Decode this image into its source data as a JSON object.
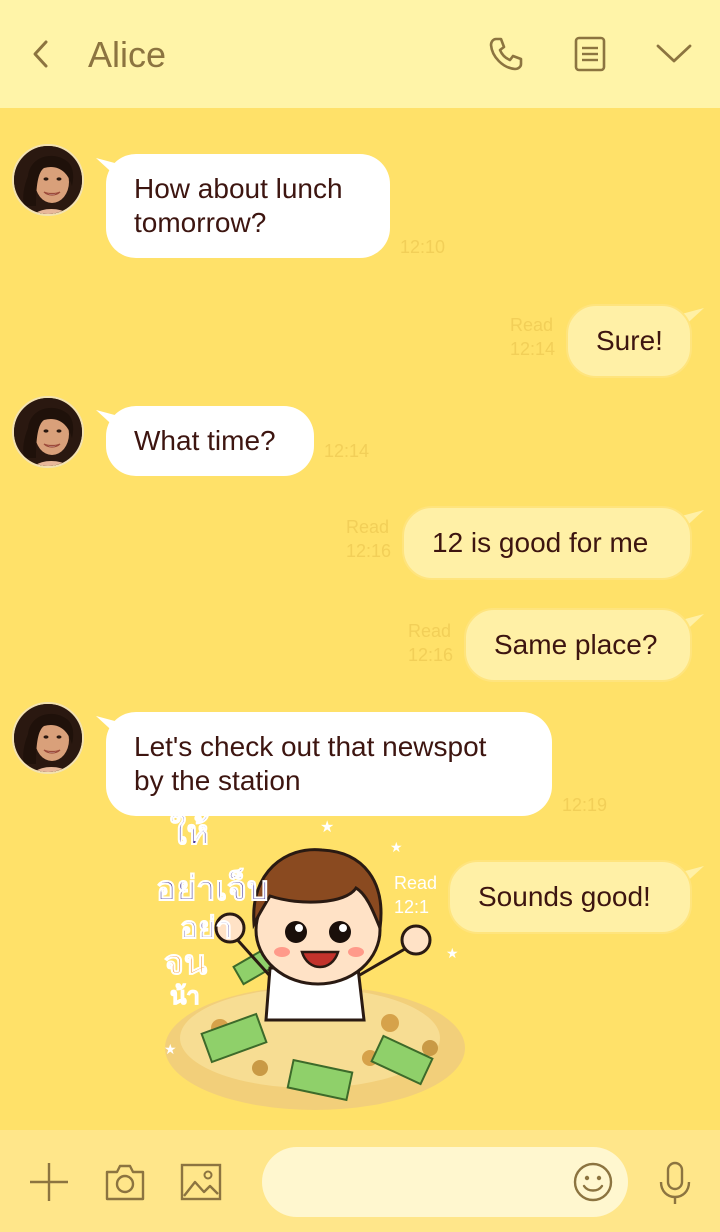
{
  "header": {
    "title": "Alice",
    "icons": [
      "back-chevron-icon",
      "phone-icon",
      "notes-icon",
      "chevron-down-icon"
    ]
  },
  "messages": [
    {
      "id": 1,
      "direction": "in",
      "lines": [
        "How about lunch",
        "tomorrow?"
      ],
      "time": "12:10"
    },
    {
      "id": 2,
      "direction": "out",
      "lines": [
        "Sure!"
      ],
      "read": "Read",
      "time": "12:14"
    },
    {
      "id": 3,
      "direction": "in",
      "lines": [
        "What time?"
      ],
      "time": "12:14"
    },
    {
      "id": 4,
      "direction": "out",
      "lines": [
        "12 is good for me"
      ],
      "read": "Read",
      "time": "12:16"
    },
    {
      "id": 5,
      "direction": "out",
      "lines": [
        "Same place?"
      ],
      "read": "Read",
      "time": "12:16"
    },
    {
      "id": 6,
      "direction": "in",
      "lines": [
        "Let's check out that newspot",
        "by the station"
      ],
      "time": "12:19"
    },
    {
      "id": 7,
      "direction": "out",
      "lines": [
        "Sounds good!"
      ],
      "read": "Read",
      "time": "12:1"
    }
  ],
  "sticker": {
    "text_lines": [
      "ให้",
      "อย่าเจ็บ",
      "อย่า",
      "จน",
      "น้า"
    ]
  },
  "inputbar": {
    "icons": [
      "plus-icon",
      "camera-icon",
      "image-icon",
      "emoji-icon",
      "microphone-icon"
    ],
    "placeholder": ""
  },
  "colors": {
    "background": "#ffe169",
    "header": "#fff4a8",
    "incoming_bubble": "#ffffff",
    "outgoing_bubble": "#fff0a6",
    "timestamp": "#f2cf58"
  }
}
